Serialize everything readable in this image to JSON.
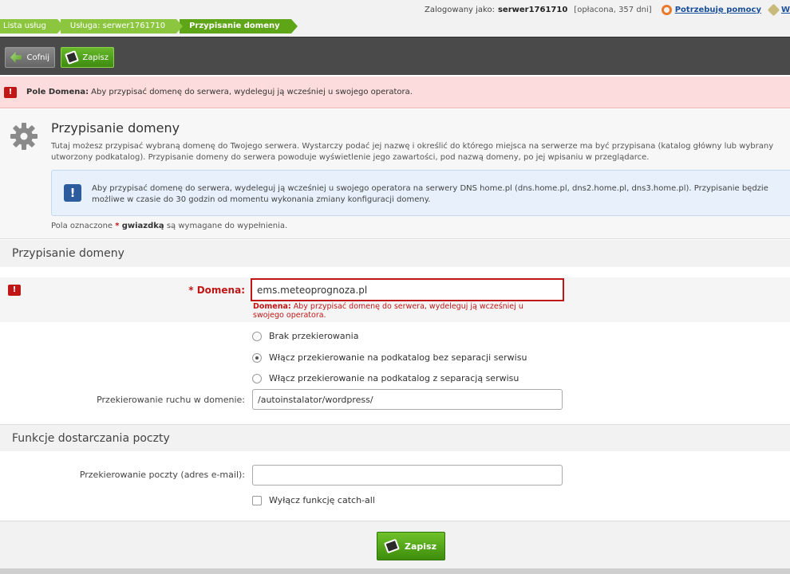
{
  "breadcrumb": [
    "Lista usług",
    "Usługa: serwer1761710",
    "Przypisanie domeny"
  ],
  "userbar": {
    "logged_as": "Zalogowany jako:",
    "username": "serwer1761710",
    "paid": "[opłacona, 357 dni]",
    "help": "Potrzebuję pomocy",
    "extra": "W"
  },
  "toolbar": {
    "back": "Cofnij",
    "save": "Zapisz"
  },
  "error_alert": {
    "field": "Pole Domena:",
    "message": "Aby przypisać domenę do serwera, wydeleguj ją wcześniej u swojego operatora."
  },
  "header": {
    "title": "Przypisanie domeny",
    "description": "Tutaj możesz przypisać wybraną domenę do Twojego serwera. Wystarczy podać jej nazwę i określić do którego miejsca na serwerze ma być przypisana (katalog główny lub wybrany utworzony podkatalog). Przypisanie domeny do serwera powoduje wyświetlenie jego zawartości, pod nazwą domeny, po jej wpisaniu w przeglądarce.",
    "info": "Aby przypisać domenę do serwera, wydeleguj ją wcześniej u swojego operatora na serwery DNS home.pl (dns.home.pl, dns2.home.pl, dns3.home.pl). Przypisanie będzie możliwe w czasie do 30 godzin od momentu wykonania zmiany konfiguracji domeny.",
    "required_prefix": "Pola oznaczone",
    "required_star": "*",
    "required_word": "gwiazdką",
    "required_suffix": "są wymagane do wypełnienia."
  },
  "domain_section": {
    "title": "Przypisanie domeny",
    "domain_star": "*",
    "domain_label": "Domena:",
    "domain_value": "ems.meteoprognoza.pl",
    "error_field": "Domena:",
    "error_text": "Aby przypisać domenę do serwera, wydeleguj ją wcześniej u swojego operatora.",
    "radios": [
      {
        "label": "Brak przekierowania",
        "checked": false
      },
      {
        "label": "Włącz przekierowanie na podkatalog bez separacji serwisu",
        "checked": true
      },
      {
        "label": "Włącz przekierowanie na podkatalog z separacją serwisu",
        "checked": false
      }
    ],
    "redirect_label": "Przekierowanie ruchu w domenie:",
    "redirect_value": "/autoinstalator/wordpress/"
  },
  "mail_section": {
    "title": "Funkcje dostarczania poczty",
    "mail_label": "Przekierowanie poczty (adres e-mail):",
    "mail_value": "",
    "catchall_label": "Wyłącz funkcję catch-all"
  },
  "footer": {
    "save": "Zapisz"
  }
}
